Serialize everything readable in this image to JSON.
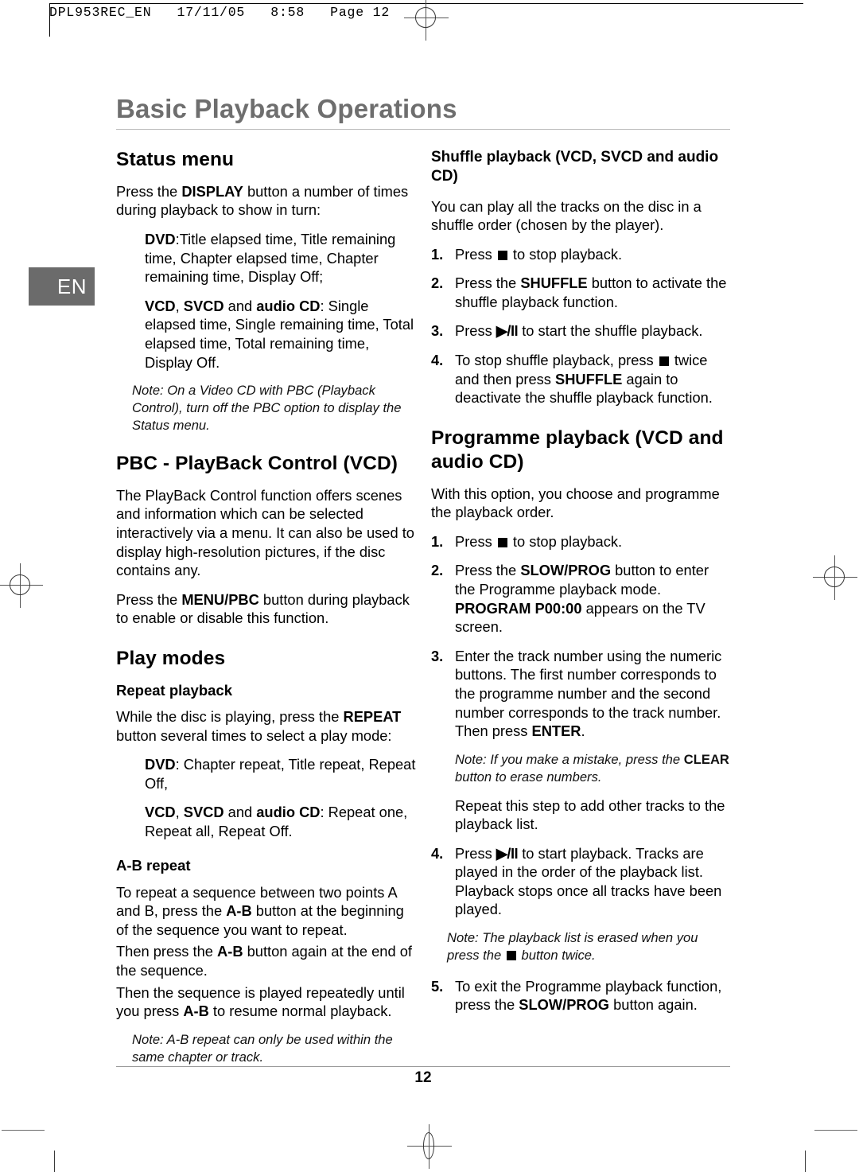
{
  "print_marks": {
    "slug_line": "DPL953REC_EN   17/11/05   8:58   Page 12"
  },
  "header": {
    "chapter_title": "Basic Playback Operations",
    "language_tab": "EN"
  },
  "footer": {
    "page_number": "12"
  },
  "left_column": {
    "status_menu": {
      "heading": "Status menu",
      "intro_a": "Press the ",
      "intro_bold": "DISPLAY",
      "intro_b": " button a number of times during playback to show in turn:",
      "dvd_label": "DVD",
      "dvd_text": ":Title elapsed time, Title remaining time, Chapter elapsed time, Chapter remaining time, Display Off;",
      "vcd_label": "VCD",
      "vcd_sep1": ", ",
      "svcd_label": "SVCD",
      "vcd_sep2": " and ",
      "cd_label": "audio CD",
      "vcd_text": ": Single elapsed time, Single remaining time, Total elapsed time, Total remaining time, Display Off.",
      "note": "Note: On a Video CD with PBC (Playback Control), turn off the PBC option to display the Status menu."
    },
    "pbc": {
      "heading": "PBC - PlayBack Control (VCD)",
      "para1": "The PlayBack Control function offers scenes and information which can be selected interactively via a menu. It can also be used to display high-resolution pictures, if the disc contains any.",
      "para2_a": "Press the ",
      "para2_bold": "MENU/PBC",
      "para2_b": " button during playback to enable or disable this function."
    },
    "play_modes": {
      "heading": "Play modes",
      "repeat": {
        "subheading": "Repeat playback",
        "intro_a": "While the disc is playing, press the ",
        "intro_bold": "REPEAT",
        "intro_b": " button several times to select a play mode:",
        "dvd_label": "DVD",
        "dvd_text": ": Chapter repeat, Title repeat, Repeat Off,",
        "vcd_label": "VCD",
        "vcd_sep1": ", ",
        "svcd_label": "SVCD",
        "vcd_sep2": " and ",
        "cd_label": "audio CD",
        "vcd_text": ": Repeat one, Repeat all, Repeat Off."
      },
      "ab_repeat": {
        "subheading": "A-B repeat",
        "p1_a": "To repeat a sequence between two points A and B, press the ",
        "p1_bold": "A-B",
        "p1_b": " button at the beginning of the sequence you want to repeat.",
        "p2_a": "Then press the ",
        "p2_bold": "A-B",
        "p2_b": " button again at the end of the sequence.",
        "p3_a": "Then the sequence is played repeatedly until you press ",
        "p3_bold": "A-B",
        "p3_b": " to resume normal playback.",
        "note": "Note: A-B repeat can only be used within the same chapter or track."
      }
    }
  },
  "right_column": {
    "shuffle": {
      "heading": "Shuffle playback (VCD, SVCD and audio CD)",
      "intro": "You can play all the tracks on the disc in a shuffle order (chosen by the player).",
      "steps": [
        {
          "num": "1.",
          "pre": "Press ",
          "icon": "stop-icon",
          "post": " to stop playback."
        },
        {
          "num": "2.",
          "pre": "Press the ",
          "bold": "SHUFFLE",
          "post": " button to activate the shuffle playback function."
        },
        {
          "num": "3.",
          "pre": "Press ",
          "icon": "play-pause-icon",
          "icon_text": "▶/II",
          "post": " to start the shuffle playback."
        },
        {
          "num": "4.",
          "pre": "To stop shuffle playback, press ",
          "icon": "stop-icon",
          "mid": " twice and then press ",
          "bold": "SHUFFLE",
          "post": " again to deactivate the shuffle playback function."
        }
      ]
    },
    "programme": {
      "heading": "Programme playback (VCD and audio CD)",
      "intro": "With this option, you choose and programme the playback order.",
      "step1": {
        "num": "1.",
        "pre": "Press ",
        "icon": "stop-icon",
        "post": " to stop playback."
      },
      "step2": {
        "num": "2.",
        "pre": "Press the ",
        "bold1": "SLOW/PROG",
        "mid": " button to enter the Programme playback mode. ",
        "bold2": "PROGRAM P00:00",
        "post": " appears on the TV screen."
      },
      "step3": {
        "num": "3.",
        "pre": "Enter the track number using the numeric buttons. The first number corresponds to the programme number and the second number corresponds to the track number. Then press ",
        "bold": "ENTER",
        "post": "."
      },
      "note1_a": "Note: If you make a mistake, press the ",
      "note1_bold": "CLEAR",
      "note1_b": " button to erase numbers.",
      "repeat_line": "Repeat this step to add other tracks to the playback list.",
      "step4": {
        "num": "4.",
        "pre": "Press ",
        "icon": "play-pause-icon",
        "icon_text": "▶/II",
        "post": " to start playback. Tracks are played in the order of the playback list. Playback stops once all tracks have been played."
      },
      "note2_a": "Note: The playback list is erased when you press the ",
      "note2_icon": "stop-icon",
      "note2_b": " button twice.",
      "step5": {
        "num": "5.",
        "pre": "To exit the Programme playback function, press the ",
        "bold": "SLOW/PROG",
        "post": " button again."
      }
    }
  }
}
